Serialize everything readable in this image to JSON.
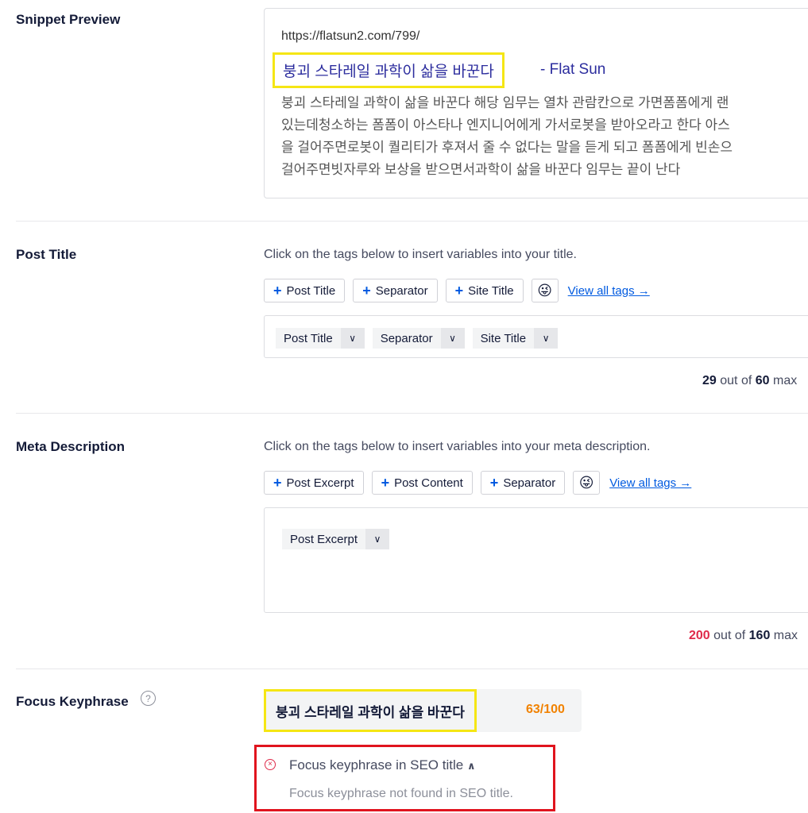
{
  "snippet_preview": {
    "label": "Snippet Preview",
    "url": "https://flatsun2.com/799/",
    "title": "붕괴 스타레일 과학이 삶을 바꾼다",
    "site_suffix": "- Flat Sun",
    "description_lines": [
      "붕괴 스타레일 과학이 삶을 바꾼다 해당 임무는 열차 관람칸으로 가면폼폼에게 랜",
      "있는데청소하는 폼폼이 아스타나 엔지니어에게 가서로봇을 받아오라고 한다 아스",
      "을 걸어주면로봇이 퀄리티가 후져서 줄 수 없다는 말을 듣게 되고 폼폼에게 빈손으",
      "걸어주면빗자루와 보상을 받으면서과학이 삶을 바꾼다 임무는 끝이 난다"
    ]
  },
  "post_title": {
    "label": "Post Title",
    "hint": "Click on the tags below to insert variables into your title.",
    "buttons": [
      "Post Title",
      "Separator",
      "Site Title"
    ],
    "view_all": "View all tags →",
    "tokens": [
      "Post Title",
      "Separator",
      "Site Title"
    ],
    "count": "29",
    "max": "60",
    "count_text": "out of",
    "max_suffix": "max"
  },
  "meta_description": {
    "label": "Meta Description",
    "hint": "Click on the tags below to insert variables into your meta description.",
    "buttons": [
      "Post Excerpt",
      "Post Content",
      "Separator"
    ],
    "view_all": "View all tags →",
    "tokens": [
      "Post Excerpt"
    ],
    "count": "200",
    "max": "160",
    "count_text": "out of",
    "max_suffix": "max"
  },
  "focus_keyphrase": {
    "label": "Focus Keyphrase",
    "help_icon": "question-circle-icon",
    "keyphrase": "붕괴 스타레일 과학이 삶을 바꾼다",
    "score": "63/100",
    "issue_title": "Focus keyphrase in SEO title",
    "issue_description": "Focus keyphrase not found in SEO title."
  },
  "colors": {
    "accent": "#005ae0",
    "error": "#df2a4a",
    "score": "#f18200",
    "highlight_yellow": "#f5e614",
    "highlight_red": "#e0141e"
  }
}
